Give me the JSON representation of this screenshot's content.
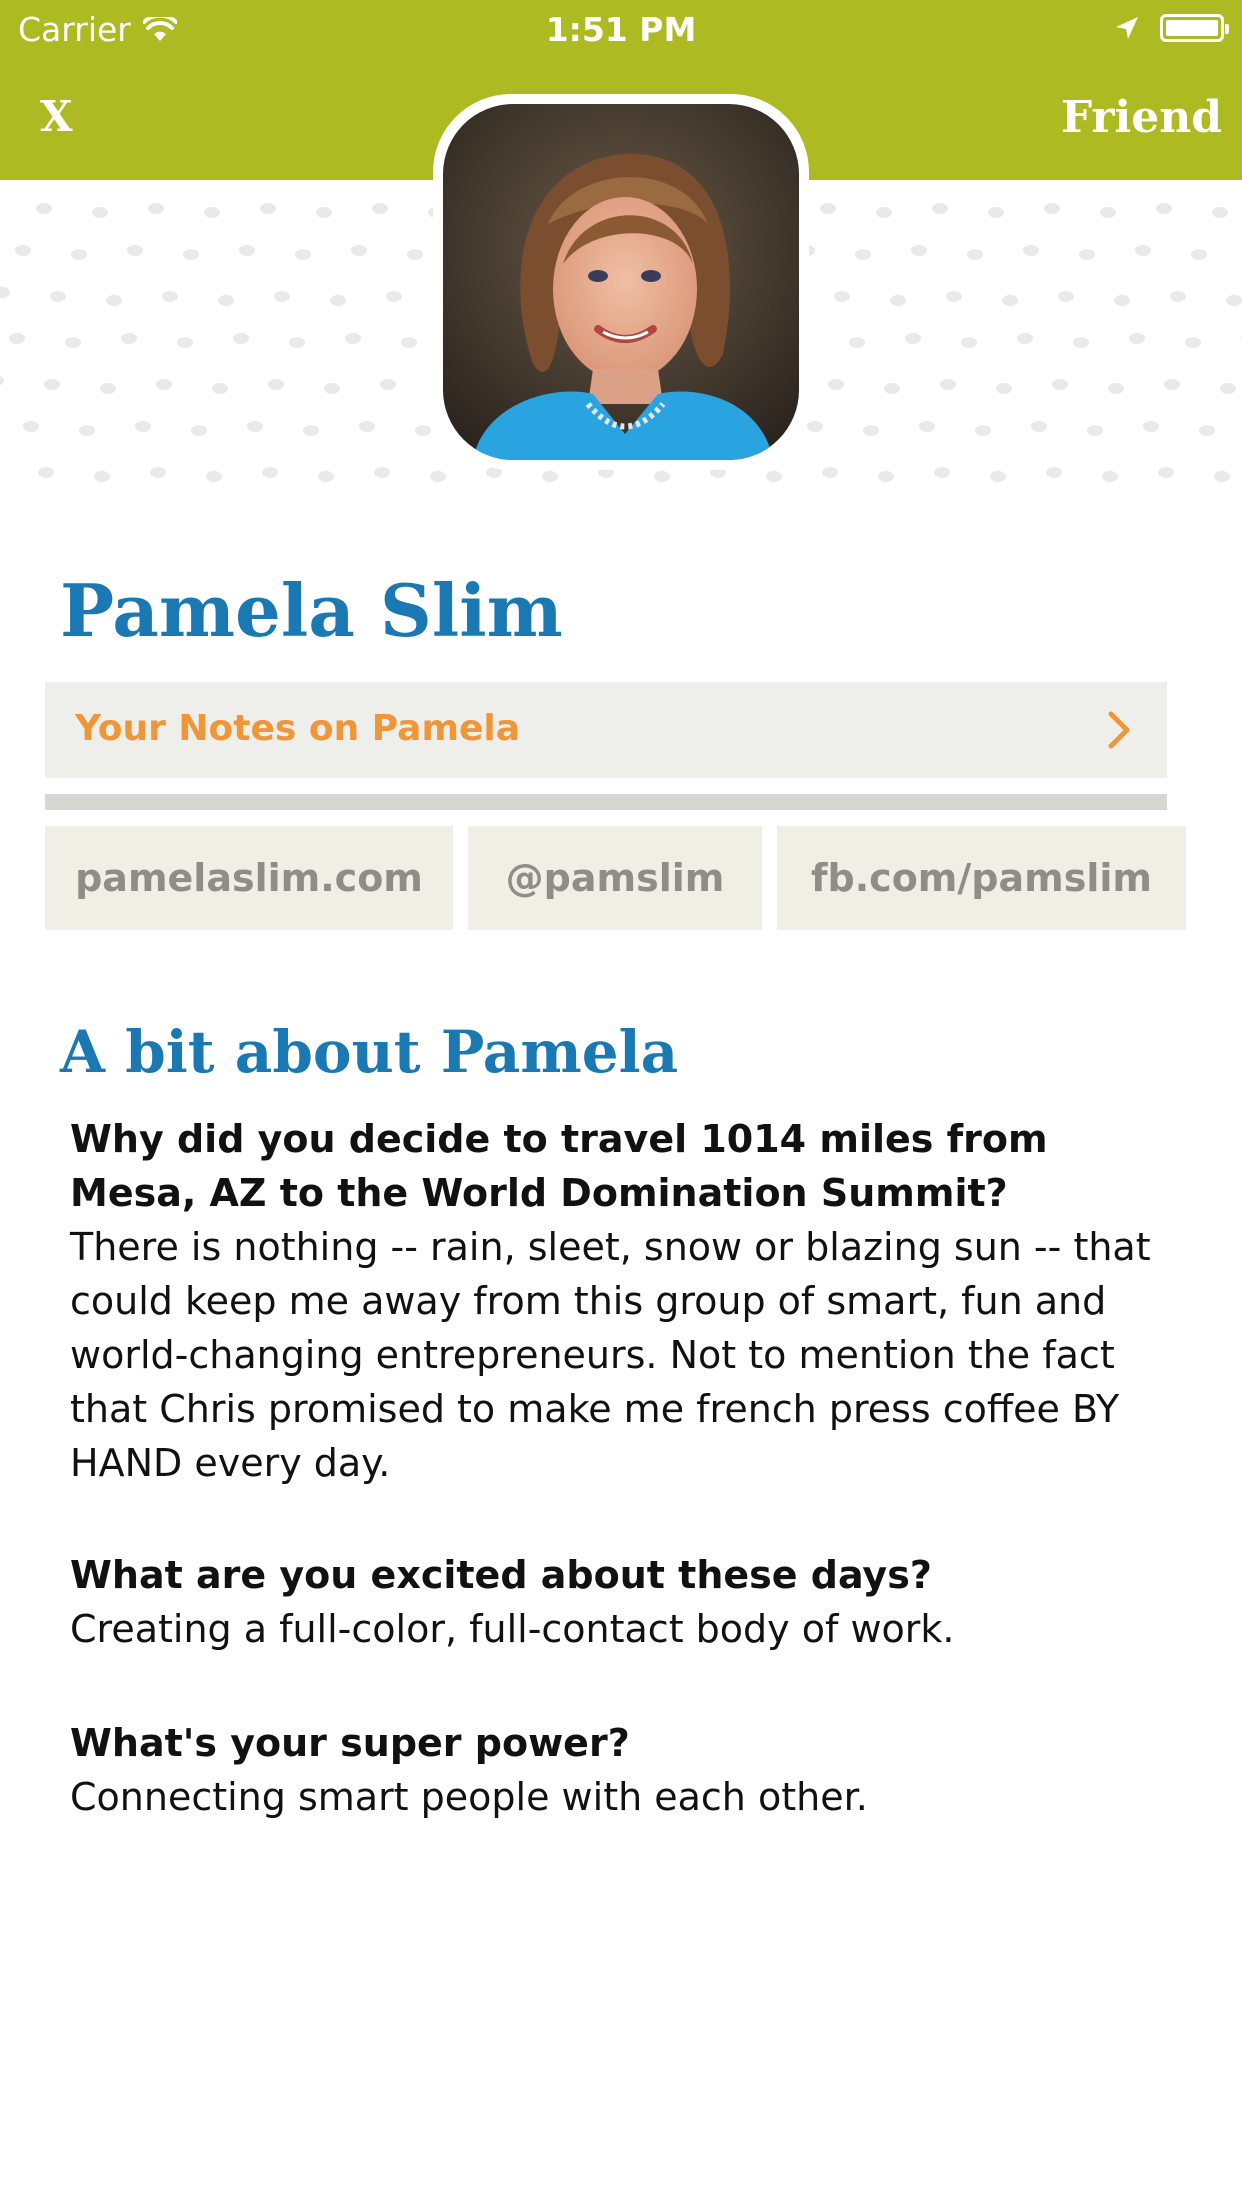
{
  "status_bar": {
    "carrier": "Carrier",
    "time": "1:51 PM"
  },
  "nav": {
    "close_label": "X",
    "friend_label": "Friend"
  },
  "colors": {
    "header": "#adba22",
    "name": "#1a79b3",
    "notes_text": "#ee9638",
    "link_bg": "#efefe6"
  },
  "profile": {
    "name": "Pamela Slim",
    "notes_label": "Your Notes on Pamela",
    "links": [
      "pamelaslim.com",
      "@pamslim",
      "fb.com/pamslim"
    ]
  },
  "about": {
    "title": "A bit about Pamela",
    "qa": [
      {
        "question": "Why did you decide to travel 1014 miles from Mesa, AZ to the World Domination Summit?",
        "answer": "There is nothing -- rain, sleet, snow or blazing sun -- that could keep me away from this group of smart, fun and world-changing entrepreneurs. Not to mention the fact that Chris promised to make me french press coffee BY HAND every day."
      },
      {
        "question": "What are you excited about these days?",
        "answer": "Creating a full-color, full-contact body of work."
      },
      {
        "question": "What's your super power?",
        "answer": "Connecting smart people with each other."
      }
    ]
  },
  "icons": {
    "wifi": "wifi-icon",
    "location": "location-arrow-icon",
    "battery": "battery-icon",
    "chevron": "chevron-right-icon"
  }
}
